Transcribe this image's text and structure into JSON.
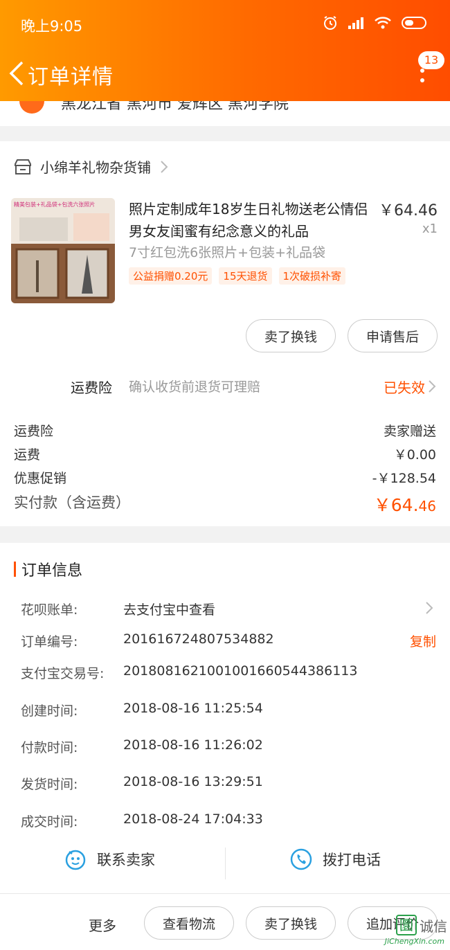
{
  "status_bar": {
    "time": "晚上9:05"
  },
  "nav": {
    "title": "订单详情",
    "badge": "13"
  },
  "address": {
    "partial_text": "黑龙江省 黑河市 爱辉区 黑河学院"
  },
  "shop": {
    "name": "小绵羊礼物杂货铺"
  },
  "product": {
    "title": "照片定制成年18岁生日礼物送老公情侣男女友闺蜜有纪念意义的礼品",
    "price": "￥64.46",
    "qty": "x1",
    "sku": "7寸红包洗6张照片+包装+礼品袋",
    "tags": [
      "公益捐赠0.20元",
      "15天退货",
      "1次破损补寄"
    ]
  },
  "product_actions": {
    "sell": "卖了换钱",
    "aftersale": "申请售后"
  },
  "insurance": {
    "label": "运费险",
    "desc": "确认收货前退货可理赔",
    "status": "已失效"
  },
  "fees": {
    "rows": [
      {
        "label": "运费险",
        "value": "卖家赠送"
      },
      {
        "label": "运费",
        "value": "￥0.00"
      },
      {
        "label": "优惠促销",
        "value": "-￥128.54"
      }
    ],
    "total_label": "实付款（含运费）",
    "total_main": "￥64.",
    "total_decimal": "46"
  },
  "order_info": {
    "title": "订单信息",
    "rows": [
      {
        "label": "花呗账单:",
        "value": "去支付宝中查看"
      },
      {
        "label": "订单编号:",
        "value": "201616724807534882",
        "action": "复制"
      },
      {
        "label": "支付宝交易号:",
        "value": "2018081621001001660544386113"
      },
      {
        "label": "创建时间:",
        "value": "2018-08-16 11:25:54"
      },
      {
        "label": "付款时间:",
        "value": "2018-08-16 11:26:02"
      },
      {
        "label": "发货时间:",
        "value": "2018-08-16 13:29:51"
      },
      {
        "label": "成交时间:",
        "value": "2018-08-24 17:04:33"
      }
    ]
  },
  "contact": {
    "seller": "联系卖家",
    "phone": "拨打电话"
  },
  "bottom": {
    "more": "更多",
    "logistics": "查看物流",
    "sell": "卖了换钱",
    "review": "追加评价"
  },
  "watermark": {
    "mark": "圜",
    "text": "诚信",
    "sub": "JiChengXin.com"
  },
  "colors": {
    "accent": "#ff5000",
    "header_start": "#ff9a00",
    "header_end": "#ff4d00"
  }
}
